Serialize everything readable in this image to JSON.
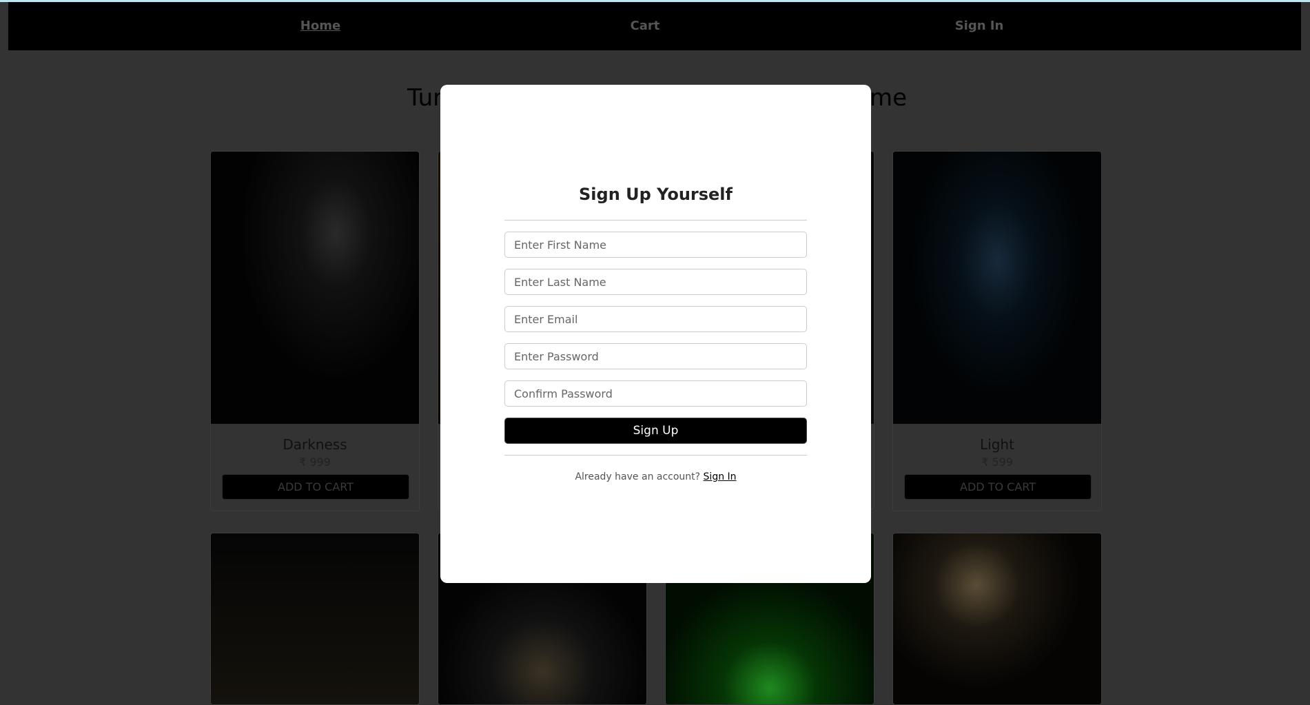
{
  "nav": {
    "items": [
      {
        "label": "Home",
        "active": true
      },
      {
        "label": "Cart"
      },
      {
        "label": "Sign In"
      }
    ]
  },
  "page": {
    "title_left": "Tur",
    "title_right": "me"
  },
  "products": [
    {
      "name": "Darkness",
      "price": "₹ 999",
      "button": "ADD TO CART"
    },
    {
      "name": "Light",
      "price": "₹ 599",
      "button": "ADD TO CART"
    }
  ],
  "modal": {
    "title": "Sign Up Yourself",
    "fields": [
      {
        "placeholder": "Enter First Name"
      },
      {
        "placeholder": "Enter Last Name"
      },
      {
        "placeholder": "Enter Email"
      },
      {
        "placeholder": "Enter Password"
      },
      {
        "placeholder": "Confirm Password"
      }
    ],
    "submit": "Sign Up",
    "footer_text": "Already have an account?",
    "footer_link": "Sign In"
  },
  "colors": {
    "overlay": "rgba(0,0,0,0.8)",
    "button": "#000000",
    "nav": "#000000"
  }
}
